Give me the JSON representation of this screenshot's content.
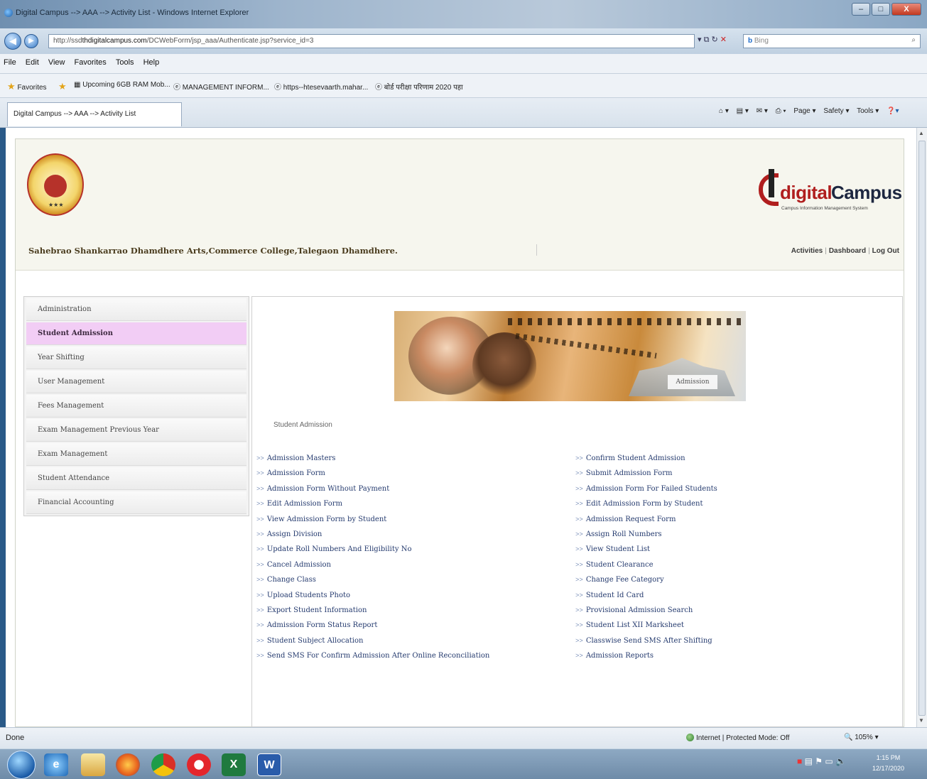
{
  "window": {
    "title": "Digital Campus --> AAA --> Activity List - Windows Internet Explorer",
    "controls": {
      "minimize": "–",
      "maximize": "□",
      "close": "X"
    }
  },
  "browser": {
    "url_prefix": "http://ssd",
    "url_domain": "thdigitalcampus.com",
    "url_path": "/DCWebForm/jsp_aaa/Authenticate.jsp?service_id=3",
    "search_placeholder": "Bing",
    "menu": [
      "File",
      "Edit",
      "View",
      "Favorites",
      "Tools",
      "Help"
    ],
    "favorites_label": "Favorites",
    "favorites": [
      "Upcoming 6GB RAM Mob...",
      "MANAGEMENT INFORM...",
      "https--htesevaarth.mahar...",
      "बोर्ड परीक्षा परिणाम 2020 पहा"
    ],
    "tab_title": "Digital Campus --> AAA --> Activity List",
    "command_bar": [
      "Page ▾",
      "Safety ▾",
      "Tools ▾"
    ],
    "status": "Done",
    "zone": "Internet | Protected Mode: Off",
    "zoom": "105%"
  },
  "page": {
    "college_name": "Sahebrao Shankarrao Dhamdhere Arts,Commerce College,Talegaon Dhamdhere.",
    "brand": {
      "word1": "digital",
      "word2": "Campus",
      "tagline": "Campus Information Management System"
    },
    "top_links": [
      "Activities",
      "Dashboard",
      "Log Out"
    ],
    "logo_stars": "★★★"
  },
  "sidebar": {
    "items": [
      {
        "label": "Administration"
      },
      {
        "label": "Student Admission"
      },
      {
        "label": "Year Shifting"
      },
      {
        "label": "User Management"
      },
      {
        "label": "Fees Management"
      },
      {
        "label": "Exam Management Previous Year"
      },
      {
        "label": "Exam Management"
      },
      {
        "label": "Student Attendance"
      },
      {
        "label": "Financial Accounting"
      }
    ],
    "active_index": 1
  },
  "content": {
    "banner_label": "Admission",
    "breadcrumb": "Student Admission",
    "arrow": ">>",
    "left_links": [
      "Admission Masters",
      "Admission Form",
      "Admission Form Without Payment",
      "Edit Admission Form",
      "View Admission Form by Student",
      "Assign Division",
      "Update Roll Numbers And Eligibility No",
      "Cancel Admission",
      "Change Class",
      "Upload Students Photo",
      "Export Student Information",
      "Admission Form Status Report",
      "Student Subject Allocation",
      "Send SMS For Confirm Admission After Online Reconciliation"
    ],
    "right_links": [
      "Confirm Student Admission",
      "Submit Admission Form",
      "Admission Form For Failed Students",
      "Edit Admission Form by Student",
      "Admission Request Form",
      "Assign Roll Numbers",
      "View Student List",
      "Student Clearance",
      "Change Fee Category",
      "Student Id Card",
      "Provisional Admission Search",
      "Student List XII Marksheet",
      "Classwise Send SMS After Shifting",
      "Admission Reports"
    ]
  },
  "taskbar": {
    "apps": [
      "internet-explorer",
      "file-explorer",
      "firefox",
      "chrome",
      "opera",
      "excel",
      "word"
    ],
    "time": "1:15 PM",
    "date": "12/17/2020"
  }
}
